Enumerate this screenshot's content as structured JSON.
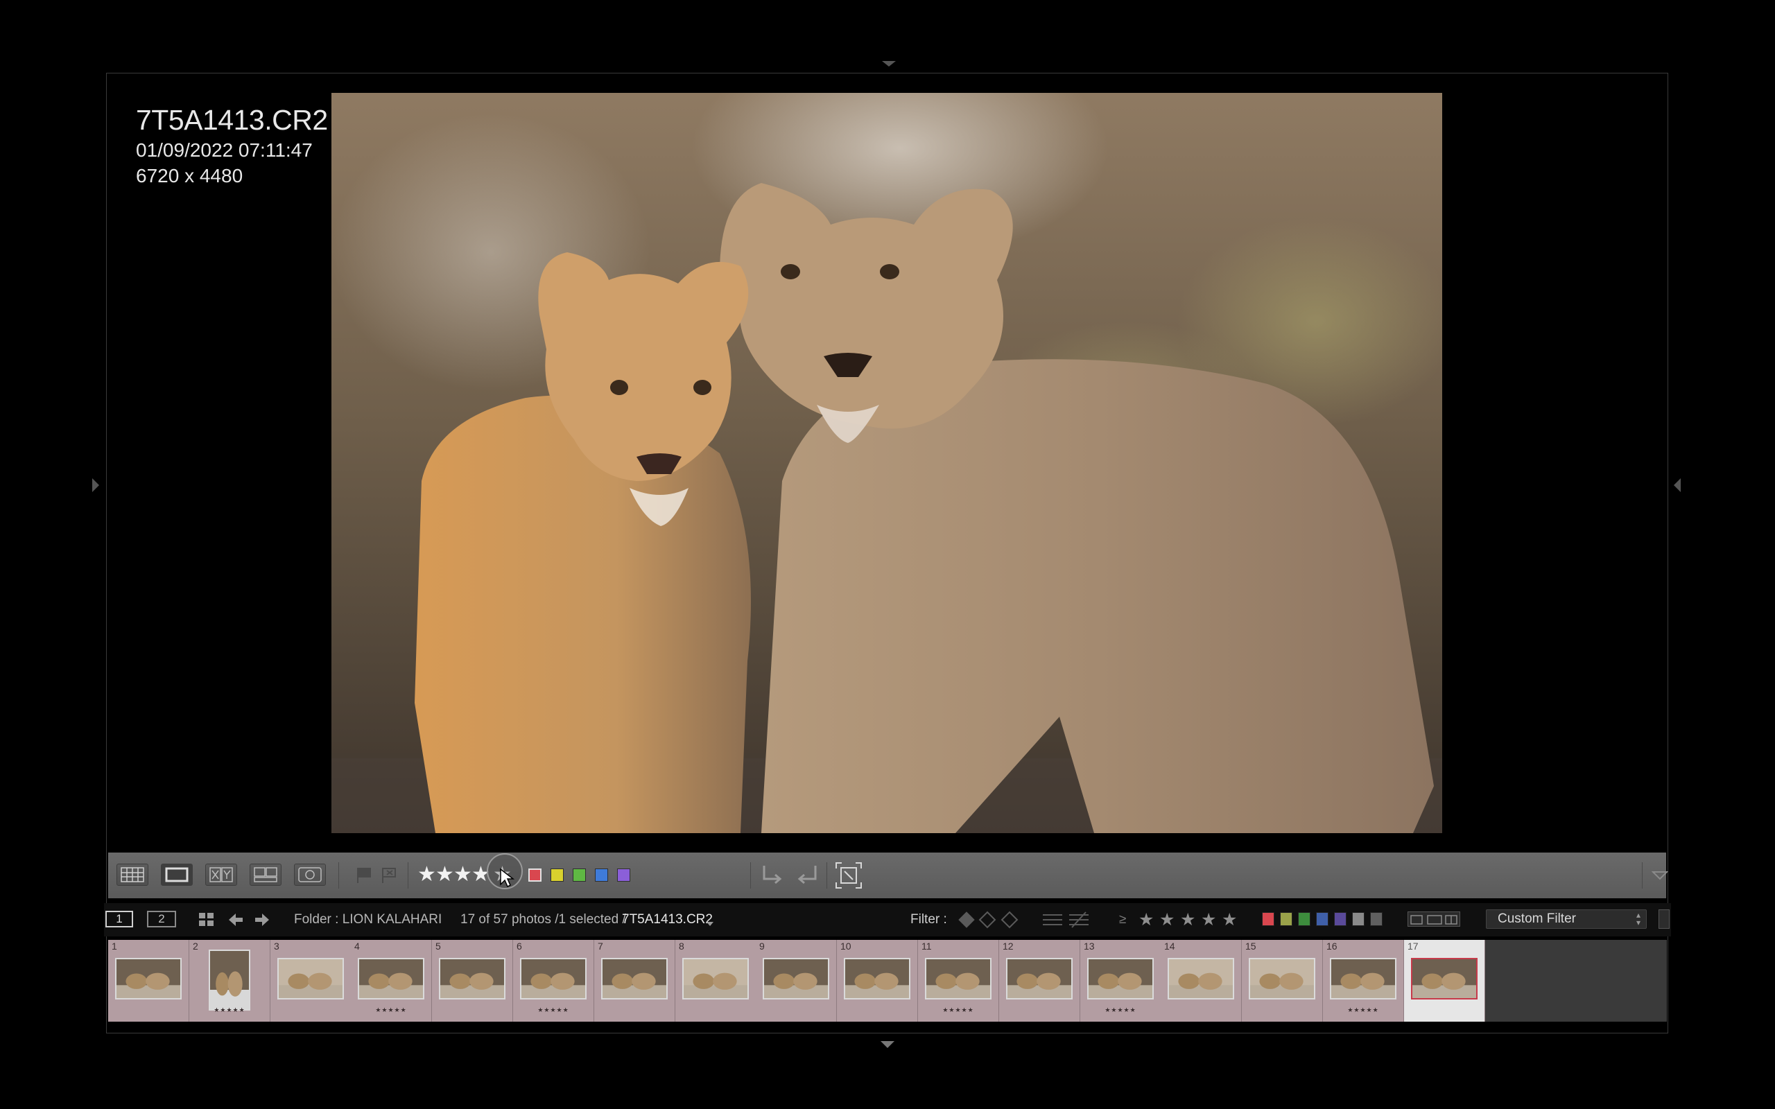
{
  "loupe": {
    "filename": "7T5A1413.CR2",
    "datetime": "01/09/2022 07:11:47",
    "dimensions": "6720 x 4480",
    "photo": "two-lionesses-photo"
  },
  "toolbar": {
    "view_buttons": [
      "grid-view-icon",
      "loupe-view-icon",
      "compare-view-icon",
      "survey-view-icon",
      "people-view-icon"
    ],
    "rating": 4,
    "color_labels": [
      "#d9474f",
      "#d9d12e",
      "#5fb843",
      "#3f7bd9",
      "#8b5fd9"
    ],
    "rotate_icons": [
      "rotate-left-icon",
      "rotate-right-icon"
    ],
    "crop_icon": "crop-overlay-icon",
    "menu_icon": "chevron-down-icon"
  },
  "filmstrip_header": {
    "screen1": "1",
    "screen2": "2",
    "source": "Folder : LION KALAHARI",
    "count": "17 of 57 photos /1 selected /",
    "selected_file": "7T5A1413.CR2",
    "filter_label": "Filter :",
    "rating_operator": "≥",
    "filter_preset": "Custom Filter",
    "filter_swatches": [
      "#d9474f",
      "#9aa24a",
      "#3d8c3d",
      "#3f5fa8",
      "#5a4a9a",
      "#8a8a8a",
      "#606060"
    ]
  },
  "filmstrip": {
    "cells": [
      {
        "num": "1",
        "stars": ""
      },
      {
        "num": "2",
        "stars": "★★★★★"
      },
      {
        "num": "3",
        "stars": ""
      },
      {
        "num": "4",
        "stars": "★★★★★"
      },
      {
        "num": "5",
        "stars": ""
      },
      {
        "num": "6",
        "stars": "★★★★★"
      },
      {
        "num": "7",
        "stars": ""
      },
      {
        "num": "8",
        "stars": ""
      },
      {
        "num": "9",
        "stars": ""
      },
      {
        "num": "10",
        "stars": ""
      },
      {
        "num": "11",
        "stars": "★★★★★"
      },
      {
        "num": "12",
        "stars": ""
      },
      {
        "num": "13",
        "stars": "★★★★★"
      },
      {
        "num": "14",
        "stars": ""
      },
      {
        "num": "15",
        "stars": ""
      },
      {
        "num": "16",
        "stars": "★★★★★"
      },
      {
        "num": "17",
        "stars": ""
      }
    ],
    "selected_index": 16
  }
}
